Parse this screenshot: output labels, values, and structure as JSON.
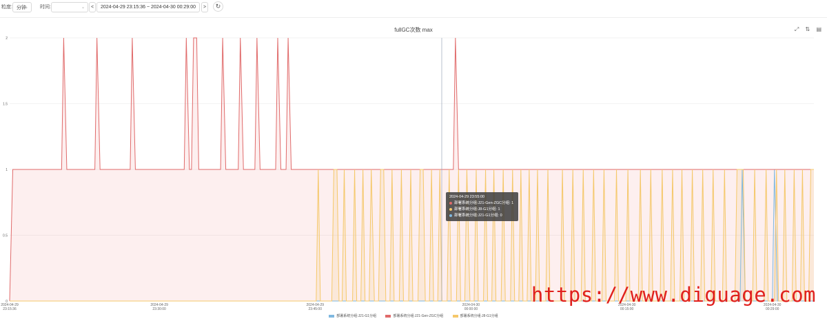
{
  "toolbar": {
    "granularity_label": "粒度:",
    "granularity_value": "分钟",
    "time_label": "时间:",
    "time_select_value": "",
    "prev": "<",
    "next": ">",
    "range_text": "2024-04-29 23:15:36 ~ 2024-04-30 00:29:00",
    "refresh_icon": "↻"
  },
  "chart_title": "fullGC次数 max",
  "tools": {
    "expand_icon": "⤢",
    "sort_icon": "⇅",
    "data_icon": "▤"
  },
  "tooltip": {
    "time": "2024-04-29 23:55:00",
    "rows": [
      {
        "text": "部署系统分组:J21-Gen-ZGC分组: 1",
        "color": "#e06a6a"
      },
      {
        "text": "部署系统分组:J8-G1分组: 1",
        "color": "#f5c86a"
      },
      {
        "text": "部署系统分组:J21-G1分组: 0",
        "color": "#7fb8e0"
      }
    ]
  },
  "watermark": "https://www.diguage.com",
  "chart_data": {
    "type": "area",
    "y_ticks": [
      "0",
      "0.5",
      "1",
      "1.5",
      "2"
    ],
    "ylim": [
      0,
      2
    ],
    "x_ticks": [
      [
        "2024-04-29",
        "23:15:36"
      ],
      [
        "2024-04-29",
        "23:30:00"
      ],
      [
        "2024-04-29",
        "23:45:00"
      ],
      [
        "2024-04-30",
        "00:00:00"
      ],
      [
        "2024-04-30",
        "00:15:00"
      ],
      [
        "2024-04-30",
        "00:29:00"
      ]
    ],
    "x_minutes": [
      0,
      1,
      2,
      4,
      5,
      6,
      7,
      9,
      10,
      11,
      13,
      14,
      15,
      17,
      18,
      19,
      20,
      23,
      24,
      25,
      26,
      27,
      29,
      30,
      31,
      33,
      34,
      35,
      36,
      37,
      39,
      40,
      41,
      42,
      43,
      45,
      46,
      47,
      48,
      49,
      50,
      52,
      53,
      54,
      55,
      56,
      57,
      58,
      60,
      61,
      62,
      63,
      64,
      65,
      67,
      68,
      69,
      70,
      71,
      72,
      73
    ],
    "series": [
      {
        "name": "部署系统分组:J21-G1分组",
        "color": "#7fb8e0",
        "points": [
          [
            0,
            0
          ],
          [
            70.3,
            0
          ],
          [
            70.5,
            1
          ],
          [
            70.8,
            0
          ],
          [
            73.4,
            0
          ],
          [
            73.6,
            1
          ],
          [
            73.9,
            0
          ],
          [
            77.4,
            0
          ]
        ]
      },
      {
        "name": "部署系统分组:J21-Gen-ZGC分组",
        "color": "#e06a6a",
        "points": [
          [
            0,
            0
          ],
          [
            0.3,
            1
          ],
          [
            5,
            1
          ],
          [
            5.2,
            2
          ],
          [
            5.5,
            1
          ],
          [
            8.2,
            1
          ],
          [
            8.4,
            2
          ],
          [
            8.7,
            1
          ],
          [
            11.6,
            1
          ],
          [
            11.8,
            2
          ],
          [
            12.1,
            1
          ],
          [
            16.8,
            1
          ],
          [
            17,
            2
          ],
          [
            17.3,
            1
          ],
          [
            17.5,
            1
          ],
          [
            17.7,
            2
          ],
          [
            18,
            2
          ],
          [
            18.2,
            1
          ],
          [
            20.3,
            1
          ],
          [
            20.5,
            2
          ],
          [
            20.8,
            1
          ],
          [
            22,
            1
          ],
          [
            22.2,
            2
          ],
          [
            22.5,
            1
          ],
          [
            23.6,
            1
          ],
          [
            23.8,
            2
          ],
          [
            24.1,
            1
          ],
          [
            25.6,
            1
          ],
          [
            25.8,
            2
          ],
          [
            26.1,
            1
          ],
          [
            26.6,
            1
          ],
          [
            26.8,
            2
          ],
          [
            27.1,
            1
          ],
          [
            42.7,
            1
          ],
          [
            42.9,
            2
          ],
          [
            43.2,
            1
          ],
          [
            77.4,
            1
          ]
        ]
      },
      {
        "name": "部署系统分组:J8-G1分组",
        "color": "#f5c86a",
        "points": [
          [
            0,
            0
          ],
          [
            29.5,
            0
          ],
          [
            29.7,
            1
          ],
          [
            29.9,
            0
          ],
          [
            31,
            0
          ],
          [
            31.2,
            1
          ],
          [
            31.5,
            1
          ],
          [
            31.7,
            0
          ],
          [
            32,
            0
          ],
          [
            32.2,
            1
          ],
          [
            32.4,
            0
          ],
          [
            33,
            0
          ],
          [
            33.2,
            1
          ],
          [
            33.4,
            0
          ],
          [
            33.8,
            0
          ],
          [
            34,
            1
          ],
          [
            34.2,
            0
          ],
          [
            34.6,
            0
          ],
          [
            34.8,
            1
          ],
          [
            35.1,
            0
          ],
          [
            35.5,
            0
          ],
          [
            35.7,
            1
          ],
          [
            36,
            1
          ],
          [
            36.2,
            0
          ],
          [
            36.6,
            0
          ],
          [
            36.8,
            1
          ],
          [
            37,
            0
          ],
          [
            37.5,
            0
          ],
          [
            37.7,
            1
          ],
          [
            37.9,
            0
          ],
          [
            38.4,
            0
          ],
          [
            38.6,
            1
          ],
          [
            38.8,
            0
          ],
          [
            39.3,
            0
          ],
          [
            39.5,
            1
          ],
          [
            39.8,
            1
          ],
          [
            40,
            0
          ],
          [
            40.4,
            0
          ],
          [
            40.6,
            1
          ],
          [
            40.8,
            0
          ],
          [
            41.2,
            0
          ],
          [
            41.4,
            1
          ],
          [
            41.6,
            0
          ],
          [
            42.1,
            0
          ],
          [
            42.3,
            1
          ],
          [
            42.5,
            0
          ],
          [
            43,
            0
          ],
          [
            43.2,
            1
          ],
          [
            43.4,
            0
          ],
          [
            43.8,
            0
          ],
          [
            44,
            1
          ],
          [
            44.3,
            0
          ],
          [
            44.7,
            0
          ],
          [
            44.9,
            1
          ],
          [
            45.1,
            0
          ],
          [
            45.6,
            0
          ],
          [
            45.8,
            1
          ],
          [
            46,
            0
          ],
          [
            46.4,
            0
          ],
          [
            46.6,
            1
          ],
          [
            46.8,
            0
          ],
          [
            47.3,
            0
          ],
          [
            47.5,
            1
          ],
          [
            47.7,
            0
          ],
          [
            48.2,
            0
          ],
          [
            48.4,
            1
          ],
          [
            48.6,
            0
          ],
          [
            49,
            0
          ],
          [
            49.2,
            1
          ],
          [
            49.4,
            0
          ],
          [
            49.8,
            0
          ],
          [
            50,
            1
          ],
          [
            50.2,
            0
          ],
          [
            50.6,
            0
          ],
          [
            50.8,
            1
          ],
          [
            51,
            0
          ],
          [
            51.6,
            0
          ],
          [
            51.8,
            1
          ],
          [
            52,
            0
          ],
          [
            53,
            0
          ],
          [
            53.2,
            1
          ],
          [
            53.4,
            0
          ],
          [
            54,
            0
          ],
          [
            54.2,
            1
          ],
          [
            54.4,
            0
          ],
          [
            55,
            0
          ],
          [
            55.2,
            1
          ],
          [
            55.4,
            0
          ],
          [
            56,
            0
          ],
          [
            56.2,
            1
          ],
          [
            56.4,
            0
          ],
          [
            57,
            0
          ],
          [
            57.2,
            1
          ],
          [
            57.4,
            0
          ],
          [
            58.2,
            0
          ],
          [
            58.4,
            1
          ],
          [
            58.6,
            0
          ],
          [
            59.3,
            0
          ],
          [
            59.5,
            1
          ],
          [
            59.7,
            0
          ],
          [
            60.5,
            0
          ],
          [
            60.7,
            1
          ],
          [
            60.9,
            0
          ],
          [
            61.5,
            0
          ],
          [
            61.7,
            1
          ],
          [
            61.9,
            0
          ],
          [
            62.6,
            0
          ],
          [
            62.8,
            1
          ],
          [
            63,
            0
          ],
          [
            63.6,
            0
          ],
          [
            63.8,
            1
          ],
          [
            64,
            0
          ],
          [
            64.5,
            0
          ],
          [
            64.7,
            1
          ],
          [
            64.9,
            0
          ],
          [
            65.5,
            0
          ],
          [
            65.7,
            1
          ],
          [
            65.9,
            0
          ],
          [
            66.5,
            0
          ],
          [
            66.7,
            1
          ],
          [
            66.9,
            0
          ],
          [
            67.5,
            0
          ],
          [
            67.7,
            1
          ],
          [
            67.9,
            0
          ],
          [
            68.6,
            0
          ],
          [
            68.8,
            1
          ],
          [
            69,
            0
          ],
          [
            69.8,
            0
          ],
          [
            70,
            1
          ],
          [
            70.6,
            1
          ],
          [
            70.8,
            0
          ],
          [
            71.5,
            0
          ],
          [
            71.7,
            1
          ],
          [
            71.9,
            0
          ],
          [
            72.6,
            0
          ],
          [
            72.8,
            1
          ],
          [
            73,
            0
          ],
          [
            73.6,
            0
          ],
          [
            73.8,
            1
          ],
          [
            74,
            0
          ],
          [
            74.4,
            0
          ],
          [
            74.6,
            1
          ],
          [
            74.8,
            0
          ],
          [
            75.3,
            0
          ],
          [
            75.5,
            1
          ],
          [
            75.7,
            0
          ],
          [
            76.1,
            0
          ],
          [
            76.3,
            1
          ],
          [
            76.5,
            0
          ],
          [
            76.9,
            0
          ],
          [
            77.1,
            1
          ],
          [
            77.4,
            1
          ]
        ]
      }
    ],
    "legend": "bottom-center",
    "grid": true
  }
}
